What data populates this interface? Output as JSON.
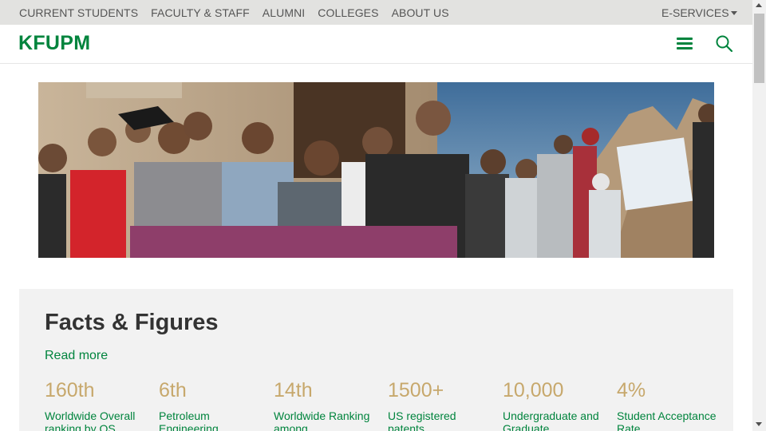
{
  "topnav": {
    "items": [
      "CURRENT STUDENTS",
      "FACULTY & STAFF",
      "ALUMNI",
      "COLLEGES",
      "ABOUT US"
    ],
    "eservices": "E-SERVICES"
  },
  "header": {
    "logo": "KFUPM",
    "menu_icon": "hamburger-menu-icon",
    "search_icon": "search-icon"
  },
  "colors": {
    "brand_green": "#00843d",
    "gold": "#c7a86c",
    "topbar_bg": "#e2e2e0",
    "facts_bg": "#f2f2f2"
  },
  "facts": {
    "title": "Facts & Figures",
    "read_more": "Read more",
    "stats": [
      {
        "value": "160th",
        "label": "Worldwide Overall ranking by QS"
      },
      {
        "value": "6th",
        "label": "Petroleum Engineering"
      },
      {
        "value": "14th",
        "label": "Worldwide Ranking among"
      },
      {
        "value": "1500+",
        "label": "US registered patents"
      },
      {
        "value": "10,000",
        "label": "Undergraduate and Graduate"
      },
      {
        "value": "4%",
        "label": "Student Acceptance Rate"
      }
    ]
  }
}
